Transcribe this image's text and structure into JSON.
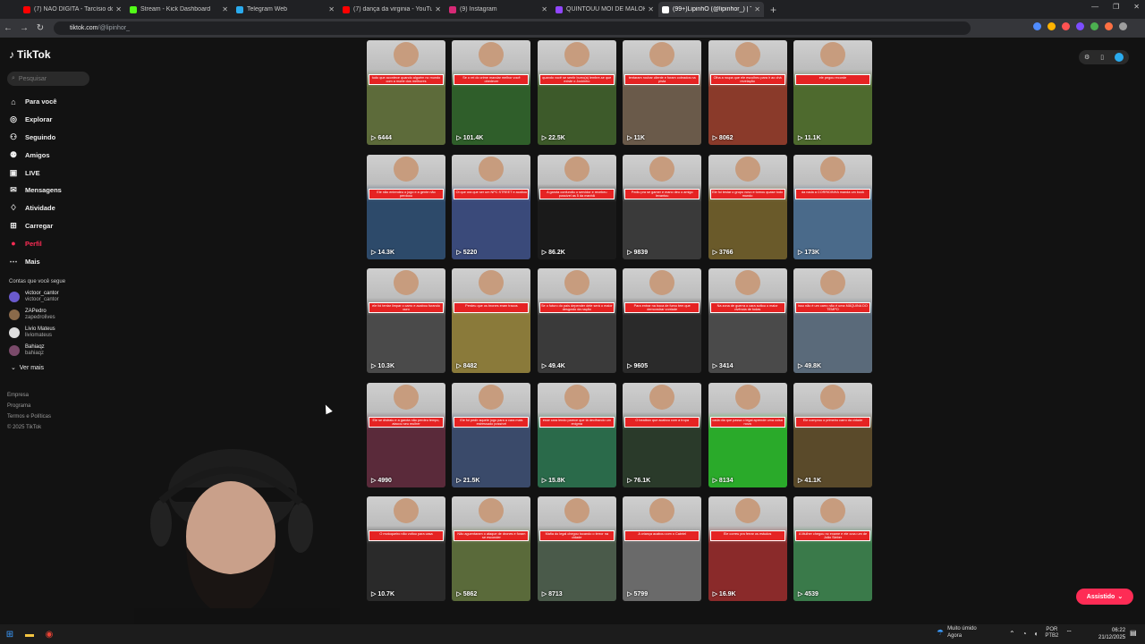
{
  "browser": {
    "tabs": [
      {
        "title": "(7) NÃO DIGITA - Tarcísio do A",
        "icon_color": "#ff0000",
        "active": false
      },
      {
        "title": "Stream - Kick Dashboard",
        "icon_color": "#53fc18",
        "active": false
      },
      {
        "title": "Telegram Web",
        "icon_color": "#2aabee",
        "active": false
      },
      {
        "title": "(7) dança da virginia - YouTube",
        "icon_color": "#ff0000",
        "active": false
      },
      {
        "title": "(9) Instagram",
        "icon_color": "#d62976",
        "active": false
      },
      {
        "title": "QUINTOUU MOI DE MALOKEI!",
        "icon_color": "#9146ff",
        "active": false
      },
      {
        "title": "(99+)LipinhO (@lipinhor_) | Tik",
        "icon_color": "#ffffff",
        "active": true
      }
    ],
    "url_host": "tiktok.com",
    "url_path": "/@lipinhor_",
    "new_tab": "+",
    "extension_colors": [
      "#4f8cff",
      "#ffb300",
      "#ff5252",
      "#7c4dff",
      "#4caf50",
      "#ff7043",
      "#9e9e9e"
    ]
  },
  "sidebar": {
    "brand": "TikTok",
    "search_placeholder": "Pesquisar",
    "nav": [
      {
        "label": "Para você",
        "icon": "home-icon",
        "glyph": "⌂"
      },
      {
        "label": "Explorar",
        "icon": "compass-icon",
        "glyph": "◎"
      },
      {
        "label": "Seguindo",
        "icon": "following-icon",
        "glyph": "⚇"
      },
      {
        "label": "Amigos",
        "icon": "friends-icon",
        "glyph": "⚉"
      },
      {
        "label": "LIVE",
        "icon": "live-icon",
        "glyph": "▣"
      },
      {
        "label": "Mensagens",
        "icon": "messages-icon",
        "glyph": "✉"
      },
      {
        "label": "Atividade",
        "icon": "activity-icon",
        "glyph": "♢"
      },
      {
        "label": "Carregar",
        "icon": "upload-icon",
        "glyph": "⊞"
      },
      {
        "label": "Perfil",
        "icon": "profile-icon",
        "glyph": "●"
      },
      {
        "label": "Mais",
        "icon": "more-icon",
        "glyph": "⋯"
      }
    ],
    "following_title": "Contas que você segue",
    "accounts": [
      {
        "name": "victoor_cantor",
        "handle": "victoor_cantor"
      },
      {
        "name": "ZAPedro",
        "handle": "zapedrolives"
      },
      {
        "name": "Livio Mateus",
        "handle": "liviomateus"
      },
      {
        "name": "Bahiaqz",
        "handle": "bahiaqz"
      }
    ],
    "see_more": "Ver mais",
    "footer": [
      "Empresa",
      "Programa",
      "Termos e Políticas",
      "© 2025 TikTok"
    ]
  },
  "videos": [
    {
      "views": "6444",
      "caption": "tudo que acontece quando alguém no mundo com a morte dos melhores",
      "bg": "#5d6b3a"
    },
    {
      "views": "101.4K",
      "caption": "Se o rei do crime mandar melhor você obedecer",
      "bg": "#2f5e2a"
    },
    {
      "views": "22.5K",
      "caption": "quando você se sentir burro(a) lembre-se que existe o Jockinho",
      "bg": "#3d5a2a"
    },
    {
      "views": "11K",
      "caption": "tentaram roubar cliente e foram cobrados na pista",
      "bg": "#6a5a4a"
    },
    {
      "views": "8062",
      "caption": "Olha a roupa que ele escolheu para ir ao chá revelação",
      "bg": "#8a3a2a"
    },
    {
      "views": "11.1K",
      "caption": "ele pegou recorde",
      "bg": "#4e6a2e"
    },
    {
      "views": "14.3K",
      "caption": "Ele não entendeu o jogo e a gente não perdoou",
      "bg": "#2d4a6a"
    },
    {
      "views": "5220",
      "caption": "Oi que ora que ser um NPC STREET e acabou",
      "bg": "#3a4a7a"
    },
    {
      "views": "86.2K",
      "caption": "A garota confundiu o servidor e recebeu possível as 5 da manhã",
      "bg": "#1a1a1a"
    },
    {
      "views": "9839",
      "caption": "Pediu pra se gamer e mano deu o amigo levantou",
      "bg": "#3a3a3a"
    },
    {
      "views": "3766",
      "caption": "Ele foi testar o grupo novo e tomou quase todo mundo",
      "bg": "#6a5a2a"
    },
    {
      "views": "173K",
      "caption": "da nada a CORRIDINHA manda um book",
      "bg": "#4a6a8a"
    },
    {
      "views": "10.3K",
      "caption": "ele foi tentar limpar o carro e acabou furando ouro",
      "bg": "#4a4a4a"
    },
    {
      "views": "8482",
      "caption": "Perdeu que os brones eram tracos",
      "bg": "#8a7a3a"
    },
    {
      "views": "49.4K",
      "caption": "Se o futuro do país depender dele será o maior desgosto da nação",
      "bg": "#3a3a3a"
    },
    {
      "views": "9605",
      "caption": "Para entrar na boca de fumo tem que demonstrar vontade",
      "bg": "#2a2a2a"
    },
    {
      "views": "3414",
      "caption": "Na zona de guerra o cara soltou o maior vivência de todas",
      "bg": "#4a4a4a"
    },
    {
      "views": "49.8K",
      "caption": "isso não é um carro não é uma MÁQUINA DO TEMPO",
      "bg": "#5a6a7a"
    },
    {
      "views": "4990",
      "caption": "Ele se distraiu e a garota não perdeu tempo, atacou seu mulher",
      "bg": "#5a2a3a"
    },
    {
      "views": "21.5K",
      "caption": "Ele foi pedir aquele jogo para a cara mais estressado possível",
      "bg": "#3a4a6a"
    },
    {
      "views": "15.8K",
      "caption": "esse cara lendo parece que tá decifrando um enigma",
      "bg": "#2a6a4a"
    },
    {
      "views": "76.1K",
      "caption": "O beatbox que acabou com a tropa",
      "bg": "#2a3a2a"
    },
    {
      "views": "8134",
      "caption": "cada dia que passa o legal aprende uma coisa nova",
      "bg": "#2aaa2a"
    },
    {
      "views": "41.1K",
      "caption": "Ele comprou o primeiro carro da cidade",
      "bg": "#5a4a2a"
    },
    {
      "views": "10.7K",
      "caption": "O motoqueiro não voltou para casa",
      "bg": "#2a2a2a"
    },
    {
      "views": "5862",
      "caption": "Não aguentaram o ataque de drones e foram se esconder",
      "bg": "#5a6a3a"
    },
    {
      "views": "8713",
      "caption": "Mafia do legal chegou tocando o terror na cidade",
      "bg": "#4a5a4a"
    },
    {
      "views": "5799",
      "caption": "A criança acabou com o Cabriel",
      "bg": "#6a6a6a"
    },
    {
      "views": "16.9K",
      "caption": "Ele correu pra ferrar os estudos",
      "bg": "#8a2a2a"
    },
    {
      "views": "4539",
      "caption": "A Mulher chegou no exame e ele cuvu um de João Sieber",
      "bg": "#3a7a4a"
    }
  ],
  "fab_label": "Assistido",
  "taskbar": {
    "weather_title": "Muito úmido",
    "weather_sub": "Agora",
    "lang_1": "POR",
    "lang_2": "PTB2",
    "time": "06:22",
    "date": "21/12/2025"
  }
}
